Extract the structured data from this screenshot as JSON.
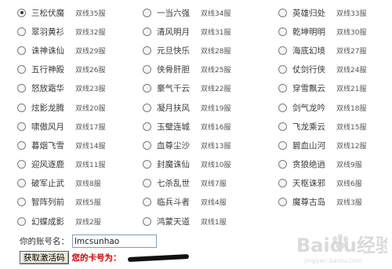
{
  "servers": [
    {
      "name": "三松伏魔",
      "line": "双线35服",
      "selected": true
    },
    {
      "name": "一当六强",
      "line": "双线34服",
      "selected": false
    },
    {
      "name": "英雄归处",
      "line": "双线33服",
      "selected": false
    },
    {
      "name": "翠羽黄衫",
      "line": "双线32服",
      "selected": false
    },
    {
      "name": "清风明月",
      "line": "双线31服",
      "selected": false
    },
    {
      "name": "乾坤明明",
      "line": "双线30服",
      "selected": false
    },
    {
      "name": "诛神诛仙",
      "line": "双线29服",
      "selected": false
    },
    {
      "name": "元旦快乐",
      "line": "双线28服",
      "selected": false
    },
    {
      "name": "海底幻境",
      "line": "双线27服",
      "selected": false
    },
    {
      "name": "五行神殿",
      "line": "双线26服",
      "selected": false
    },
    {
      "name": "侠骨肝胆",
      "line": "双线25服",
      "selected": false
    },
    {
      "name": "仗剑行侠",
      "line": "双线24服",
      "selected": false
    },
    {
      "name": "怒放霜华",
      "line": "双线23服",
      "selected": false
    },
    {
      "name": "豪气千云",
      "line": "双线22服",
      "selected": false
    },
    {
      "name": "穿雪飘云",
      "line": "双线21服",
      "selected": false
    },
    {
      "name": "炫影龙腾",
      "line": "双线20服",
      "selected": false
    },
    {
      "name": "凝月扶风",
      "line": "双线19服",
      "selected": false
    },
    {
      "name": "剑气龙吟",
      "line": "双线18服",
      "selected": false
    },
    {
      "name": "啸傲风月",
      "line": "双线17服",
      "selected": false
    },
    {
      "name": "玉璧连城",
      "line": "双线16服",
      "selected": false
    },
    {
      "name": "飞龙乘云",
      "line": "双线15服",
      "selected": false
    },
    {
      "name": "暮烟飞雪",
      "line": "双线14服",
      "selected": false
    },
    {
      "name": "血尊尘沙",
      "line": "双线13服",
      "selected": false
    },
    {
      "name": "碧血山河",
      "line": "双线12服",
      "selected": false
    },
    {
      "name": "迎风逐鹿",
      "line": "双线11服",
      "selected": false
    },
    {
      "name": "封魔诛仙",
      "line": "双线10服",
      "selected": false
    },
    {
      "name": "贪狼绝逍",
      "line": "双线9服",
      "selected": false
    },
    {
      "name": "破军止武",
      "line": "双线8服",
      "selected": false
    },
    {
      "name": "七杀乱世",
      "line": "双线7服",
      "selected": false
    },
    {
      "name": "天枢诛邪",
      "line": "双线6服",
      "selected": false
    },
    {
      "name": "智阵列前",
      "line": "双线5服",
      "selected": false
    },
    {
      "name": "临兵斗者",
      "line": "双线4服",
      "selected": false
    },
    {
      "name": "魔尊古岛",
      "line": "双线3服",
      "selected": false
    },
    {
      "name": "幻蝶成影",
      "line": "双线2服",
      "selected": false
    },
    {
      "name": "鸿蒙天道",
      "line": "双线1服",
      "selected": false
    }
  ],
  "account": {
    "label": "你的账号名：",
    "value": "lmcsunhao"
  },
  "activate": {
    "button_label": "获取激活码",
    "card_label": "您的卡号为："
  },
  "watermark": {
    "brand": "Baidu经验",
    "url": "jingyan.baidu.com"
  },
  "colors": {
    "card_label": "#cc0000",
    "radio_border": "#7d7d7d",
    "input_border": "#7f9db9"
  }
}
